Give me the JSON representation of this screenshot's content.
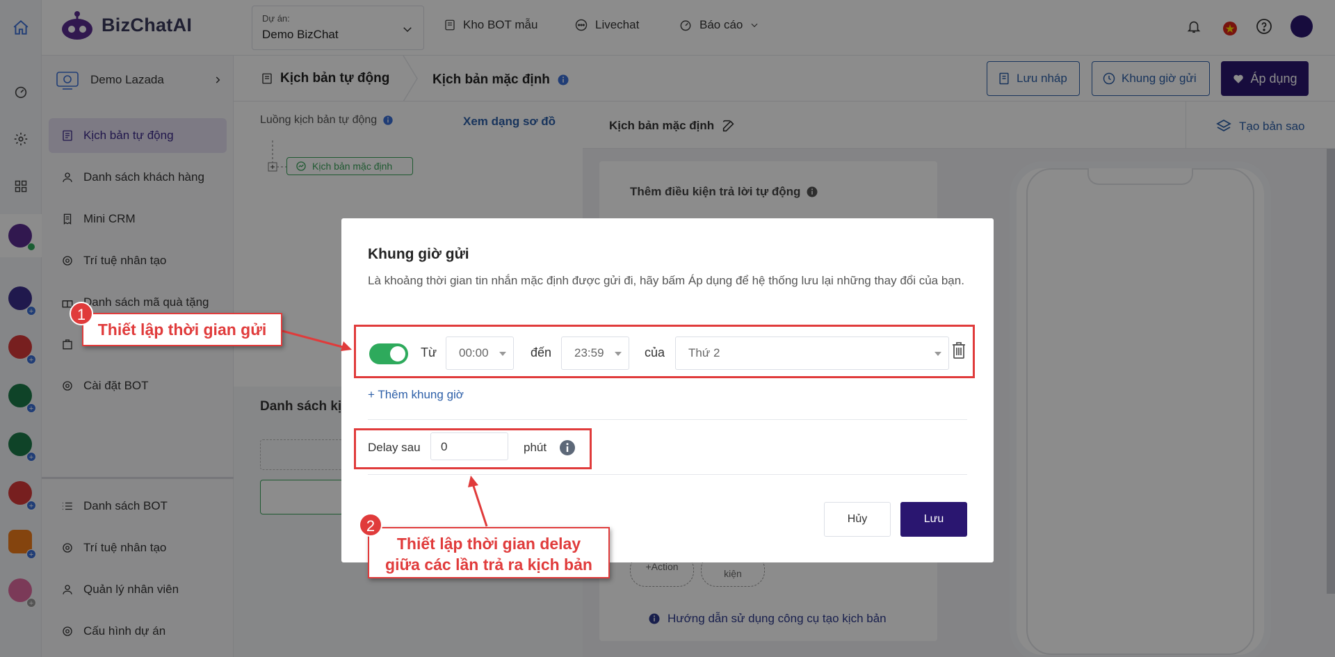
{
  "topbar": {
    "brand": "BizChatAI",
    "project_label": "Dự án:",
    "project_value": "Demo BizChat",
    "nav": [
      "Kho BOT mẫu",
      "Livechat",
      "Báo cáo"
    ]
  },
  "sidebar": {
    "header": "Demo Lazada",
    "items": [
      {
        "label": "Kịch bản tự động",
        "active": true
      },
      {
        "label": "Danh sách khách hàng"
      },
      {
        "label": "Mini CRM"
      },
      {
        "label": "Trí tuệ nhân tạo"
      },
      {
        "label": "Danh sách mã quà tặng"
      },
      {
        "label": "Cài đặt BOT"
      }
    ],
    "bottom_items": [
      {
        "label": "Danh sách BOT"
      },
      {
        "label": "Trí tuệ nhân tạo"
      },
      {
        "label": "Quản lý nhân viên"
      },
      {
        "label": "Cấu hình dự án"
      }
    ]
  },
  "header": {
    "crumb1": "Kịch bản tự động",
    "crumb2": "Kịch bản mặc định",
    "save_draft": "Lưu nháp",
    "time_frame": "Khung giờ gửi",
    "apply": "Áp dụng"
  },
  "flow": {
    "title": "Luồng kịch bản tự động",
    "view_diagram": "Xem dạng sơ đồ",
    "node_label": "Kịch bản mặc định",
    "list_title": "Danh sách kị"
  },
  "editor": {
    "title": "Kịch bản mặc định",
    "copy": "Tạo bản sao",
    "cond_title": "Thêm điều kiện trả lời tự động",
    "action_btn": "+Action",
    "cond_btn": "kiện",
    "guide": "Hướng dẫn sử dụng công cụ tạo kịch bản"
  },
  "modal": {
    "title": "Khung giờ gửi",
    "description": "Là khoảng thời gian tin nhắn mặc định được gửi đi, hãy bấm Áp dụng để hệ thống lưu lại những thay đổi của bạn.",
    "from_label": "Từ",
    "from_value": "00:00",
    "to_label": "đến",
    "to_value": "23:59",
    "of_label": "của",
    "day_value": "Thứ 2",
    "add_time": "+ Thêm khung giờ",
    "delay_label": "Delay sau",
    "delay_value": "0",
    "delay_unit": "phút",
    "cancel": "Hủy",
    "save": "Lưu",
    "toggle_on": true
  },
  "annotations": {
    "badge1": "1",
    "callout1": "Thiết lập thời gian gửi",
    "badge2": "2",
    "callout2_line1": "Thiết lập thời gian delay",
    "callout2_line2": "giữa các lần trả ra kịch bản"
  },
  "colors": {
    "brand": "#2a1670",
    "link": "#2d5fa8",
    "annotation": "#e03b3b",
    "toggle": "#2eaa5c"
  }
}
